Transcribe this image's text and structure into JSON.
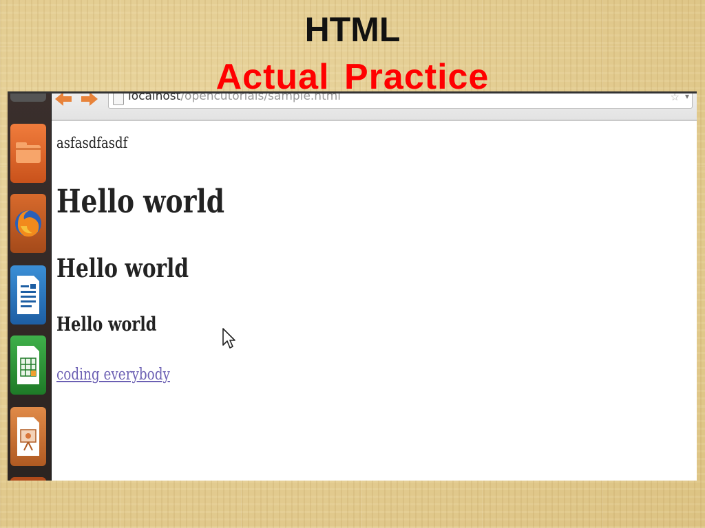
{
  "slide": {
    "title": "HTML",
    "subtitle": "Actual Practice"
  },
  "launcher": {
    "items": [
      {
        "icon": "top-launcher-icon"
      },
      {
        "icon": "files-folder-icon"
      },
      {
        "icon": "firefox-icon"
      },
      {
        "icon": "libreoffice-writer-icon"
      },
      {
        "icon": "libreoffice-calc-icon"
      },
      {
        "icon": "libreoffice-impress-icon"
      }
    ]
  },
  "browser": {
    "url_host": "localhost",
    "url_path": "/opencutorials/sample.html"
  },
  "page": {
    "paragraph": "asfasdfasdf",
    "h1": "Hello world",
    "h2": "Hello world",
    "h3": "Hello world",
    "link": "coding everybody"
  },
  "colors": {
    "subtitle": "#ff0000",
    "link": "#6b5fb3",
    "background": "#e3cd8f"
  }
}
